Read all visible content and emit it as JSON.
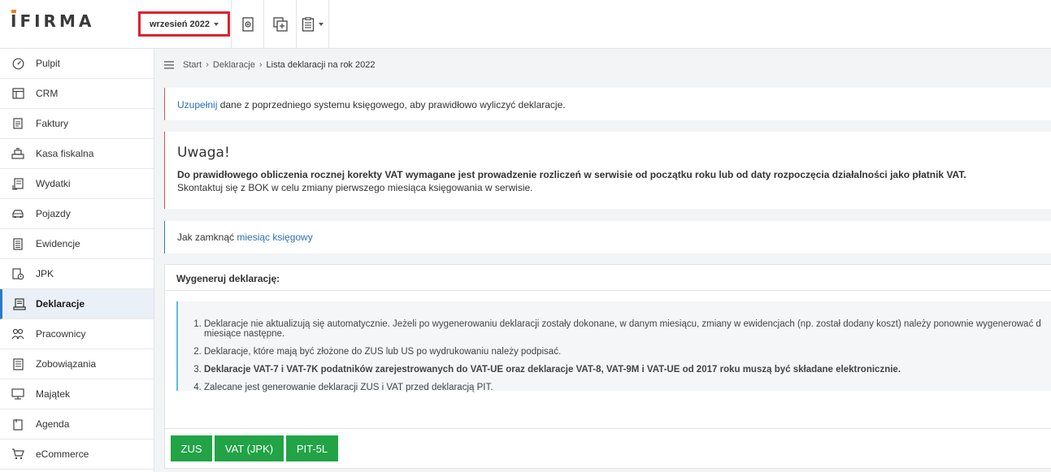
{
  "app": {
    "logo_text": "IFIRMA",
    "month_selector": "wrzesień 2022"
  },
  "sidebar": {
    "items": [
      {
        "label": "Pulpit",
        "icon": "dashboard-icon"
      },
      {
        "label": "CRM",
        "icon": "crm-icon"
      },
      {
        "label": "Faktury",
        "icon": "invoice-icon"
      },
      {
        "label": "Kasa fiskalna",
        "icon": "cash-register-icon"
      },
      {
        "label": "Wydatki",
        "icon": "expenses-icon"
      },
      {
        "label": "Pojazdy",
        "icon": "car-icon"
      },
      {
        "label": "Ewidencje",
        "icon": "records-icon"
      },
      {
        "label": "JPK",
        "icon": "jpk-icon"
      },
      {
        "label": "Deklaracje",
        "icon": "declarations-icon"
      },
      {
        "label": "Pracownicy",
        "icon": "employees-icon"
      },
      {
        "label": "Zobowiązania",
        "icon": "liabilities-icon"
      },
      {
        "label": "Majątek",
        "icon": "assets-icon"
      },
      {
        "label": "Agenda",
        "icon": "agenda-icon"
      },
      {
        "label": "eCommerce",
        "icon": "cart-icon"
      }
    ],
    "active_index": 8
  },
  "breadcrumb": {
    "items": [
      "Start",
      "Deklaracje",
      "Lista deklaracji na rok 2022"
    ]
  },
  "alerts": {
    "complete_link": "Uzupełnij",
    "complete_text": " dane z poprzedniego systemu księgowego, aby prawidłowo wyliczyć deklaracje.",
    "warning_title": "Uwaga!",
    "warning_bold": "Do prawidłowego obliczenia rocznej korekty VAT wymagane jest prowadzenie rozliczeń w serwisie od początku roku lub od daty rozpoczęcia działalności jako płatnik VAT.",
    "warning_text": "Skontaktuj się z BOK w celu zmiany pierwszego miesiąca księgowania w serwisie.",
    "close_month_text": "Jak zamknąć ",
    "close_month_link": "miesiąc księgowy"
  },
  "generate": {
    "title": "Wygeneruj deklarację:",
    "notes": [
      "Deklaracje nie aktualizują się automatycznie. Jeżeli po wygenerowaniu deklaracji zostały dokonane, w danym miesiącu, zmiany w ewidencjach (np. został dodany koszt) należy ponownie wygenerować d... miesiące następne.",
      "Deklaracje, które mają być złożone do ZUS lub US po wydrukowaniu należy podpisać.",
      "Deklaracje VAT-7 i VAT-7K podatników zarejestrowanych do VAT-UE oraz deklaracje VAT-8, VAT-9M i VAT-UE od 2017 roku muszą być składane elektronicznie.",
      "Zalecane jest generowanie deklaracji ZUS i VAT przed deklaracją PIT."
    ],
    "notes_line1a": "Deklaracje nie aktualizują się automatycznie. Jeżeli po wygenerowaniu deklaracji zostały dokonane, w danym miesiącu, zmiany w ewidencjach (np. został dodany koszt) należy ponownie wygenerować d",
    "notes_line1b": "miesiące następne.",
    "buttons": [
      "ZUS",
      "VAT (JPK)",
      "PIT-5L"
    ]
  },
  "colors": {
    "accent_red": "#e0202c",
    "button_green": "#21a346",
    "link_blue": "#2a6fb5"
  }
}
